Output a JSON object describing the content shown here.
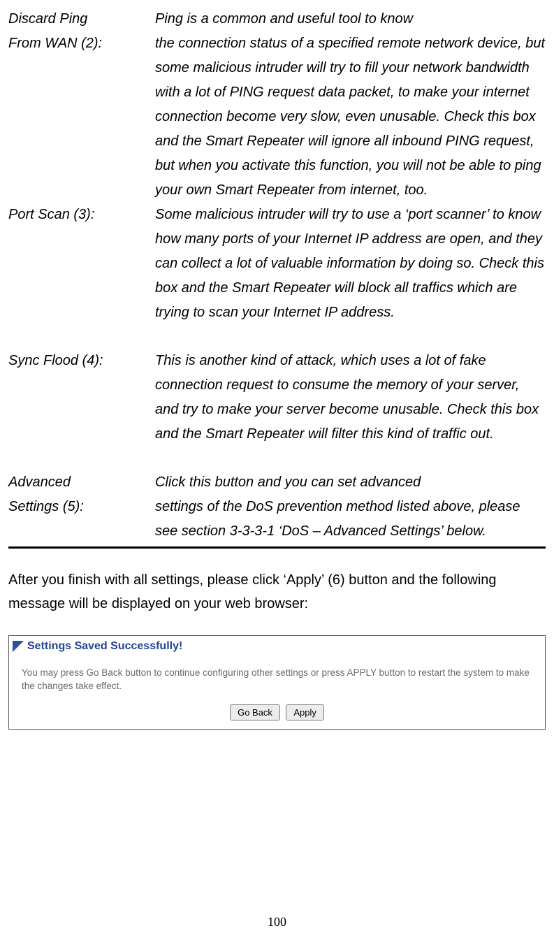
{
  "defs": {
    "discard_ping": {
      "term_l1": "Discard Ping",
      "term_l2": "From WAN (2):",
      "desc_l1": "Ping is a common and useful tool to know",
      "desc_rest": "the connection status of a specified remote network device, but some malicious intruder will try to fill your network bandwidth with a lot of PING request data packet, to make your internet connection become very slow, even unusable. Check this box and the Smart Repeater will ignore all inbound PING request, but when you activate this function, you will not be able to ping your own Smart Repeater from internet, too."
    },
    "port_scan": {
      "term": "Port Scan (3):",
      "desc": "Some malicious intruder will try to use a ‘port scanner’ to know how many ports of your Internet IP address are open, and they can collect a lot of valuable information by doing so. Check this box and the Smart Repeater will block all traffics which are trying to scan your Internet IP address."
    },
    "sync_flood": {
      "term": "Sync Flood (4):",
      "desc": "This is another kind of attack, which uses a lot of fake connection request to consume the memory of your server, and try to make your server become unusable. Check this box and the Smart Repeater will filter this kind of traffic out."
    },
    "advanced": {
      "term_l1": "Advanced",
      "term_l2": "Settings (5):",
      "desc_l1": "Click this button and you can set advanced",
      "desc_rest": "settings of the DoS prevention method listed above, please see section 3-3-3-1 ‘DoS – Advanced Settings’ below."
    }
  },
  "after_text": "After you finish with all settings, please click ‘Apply’ (6) button and the following message will be displayed on your web browser:",
  "panel": {
    "title": "Settings Saved Successfully!",
    "body": "You may press Go Back button to continue configuring other settings or press APPLY button to restart the system to make the changes take effect.",
    "go_back": "Go Back",
    "apply": "Apply"
  },
  "page_number": "100"
}
